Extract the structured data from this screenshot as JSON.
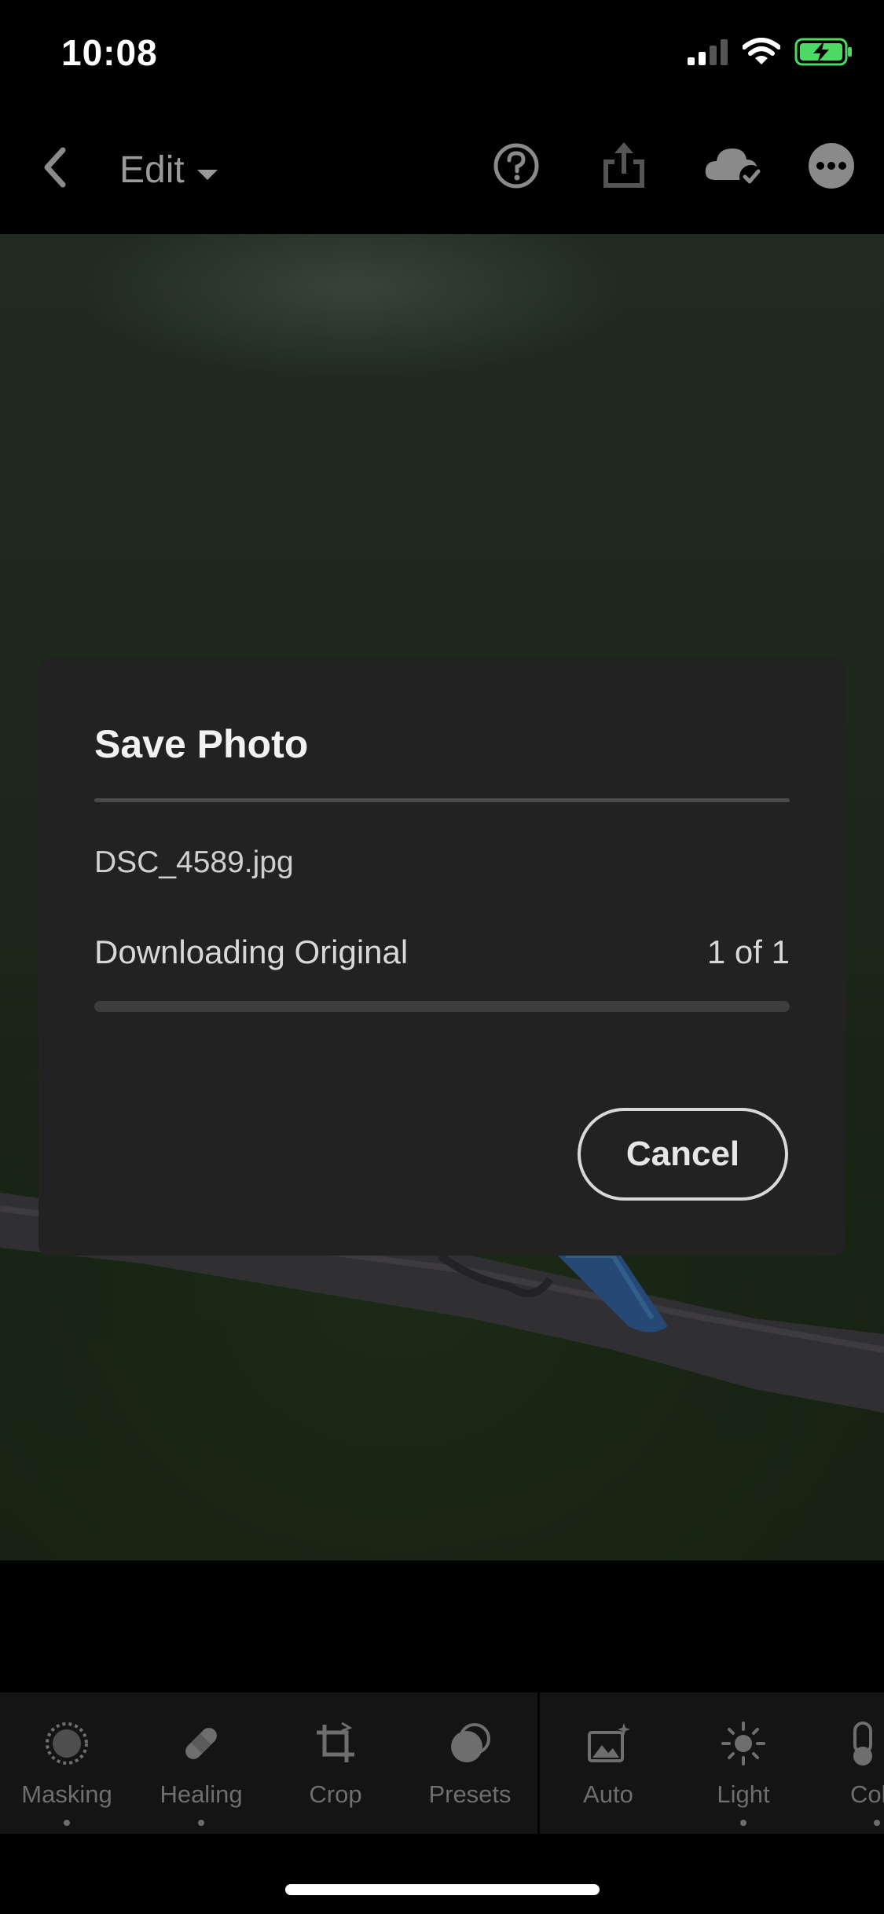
{
  "status_bar": {
    "time": "10:08",
    "icons": [
      "signal-icon",
      "wifi-icon",
      "battery-charging-icon"
    ]
  },
  "top_bar": {
    "edit_label": "Edit",
    "icons": [
      "back-icon",
      "help-icon",
      "share-icon",
      "cloud-synced-icon",
      "more-icon"
    ]
  },
  "dialog": {
    "title": "Save Photo",
    "file_name": "DSC_4589.jpg",
    "progress_label": "Downloading Original",
    "progress_count": "1 of 1",
    "progress_fraction": 0,
    "cancel_label": "Cancel"
  },
  "toolbar": {
    "tools": [
      {
        "label": "Masking",
        "icon": "masking-icon"
      },
      {
        "label": "Healing",
        "icon": "healing-icon"
      },
      {
        "label": "Crop",
        "icon": "crop-icon"
      },
      {
        "label": "Presets",
        "icon": "presets-icon"
      },
      {
        "label": "Auto",
        "icon": "auto-icon"
      },
      {
        "label": "Light",
        "icon": "light-icon"
      },
      {
        "label": "Col",
        "icon": "color-icon"
      }
    ]
  },
  "colors": {
    "background": "#000000",
    "dialog": "#222222",
    "battery_green": "#4cd964"
  }
}
